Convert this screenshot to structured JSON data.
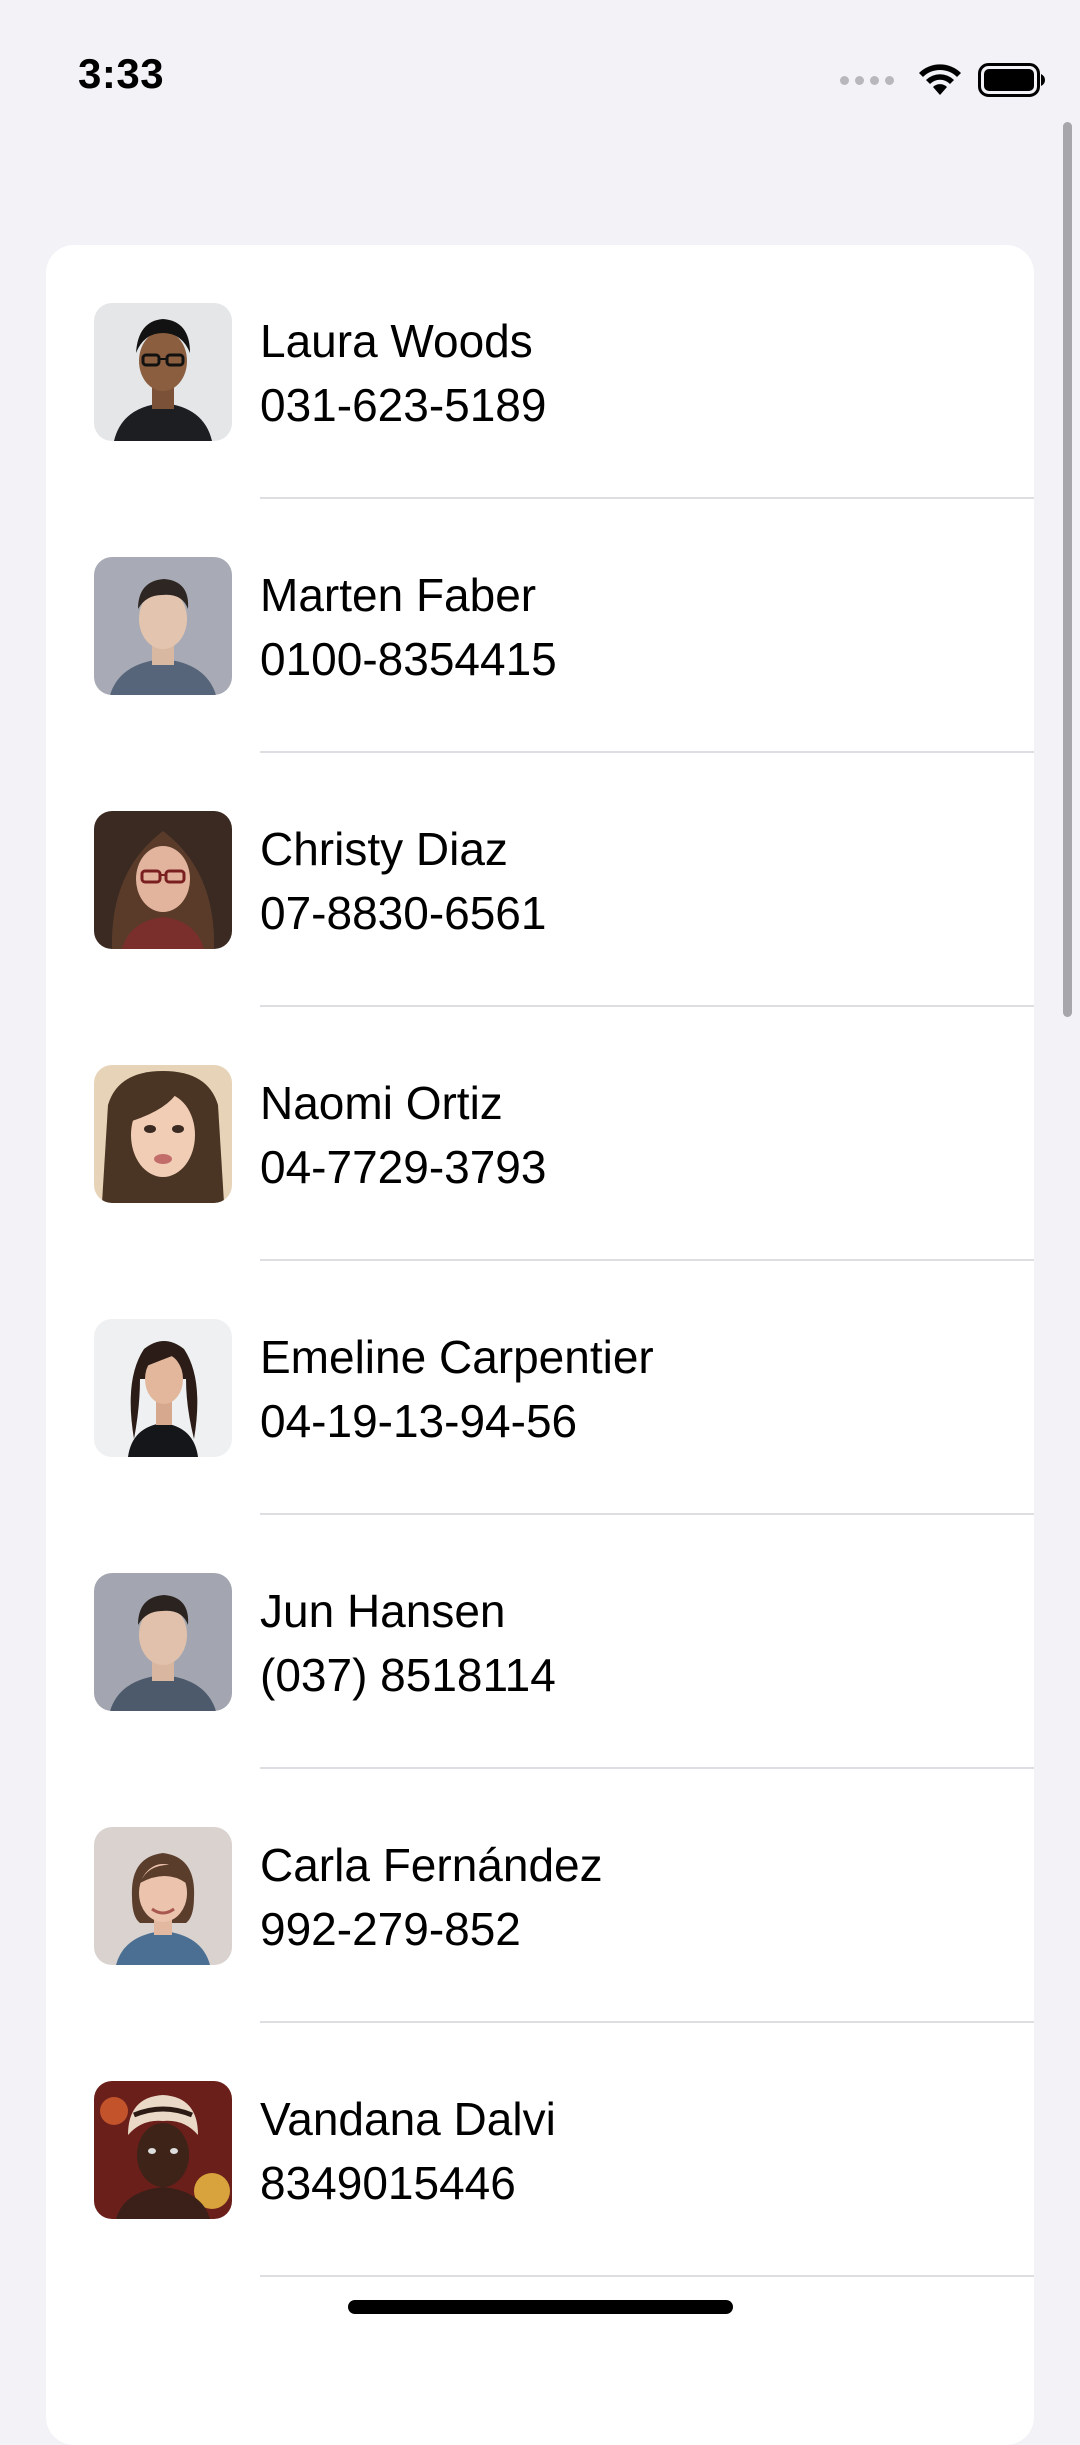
{
  "status_bar": {
    "time": "3:33",
    "icons": [
      "cellular-signal-icon",
      "wifi-icon",
      "battery-icon"
    ]
  },
  "contacts": [
    {
      "name": "Laura Woods",
      "phone": "031-623-5189",
      "avatar_icon": "avatar-photo"
    },
    {
      "name": "Marten Faber",
      "phone": "0100-8354415",
      "avatar_icon": "avatar-photo"
    },
    {
      "name": "Christy Diaz",
      "phone": "07-8830-6561",
      "avatar_icon": "avatar-photo"
    },
    {
      "name": "Naomi Ortiz",
      "phone": "04-7729-3793",
      "avatar_icon": "avatar-photo"
    },
    {
      "name": "Emeline Carpentier",
      "phone": "04-19-13-94-56",
      "avatar_icon": "avatar-photo"
    },
    {
      "name": "Jun Hansen",
      "phone": "(037) 8518114",
      "avatar_icon": "avatar-photo"
    },
    {
      "name": "Carla Fernández",
      "phone": "992-279-852",
      "avatar_icon": "avatar-photo"
    },
    {
      "name": "Vandana Dalvi",
      "phone": "8349015446",
      "avatar_icon": "avatar-photo"
    }
  ],
  "colors": {
    "background": "#f2f2f7",
    "card": "#ffffff",
    "separator": "#dedee2",
    "text": "#000000"
  }
}
